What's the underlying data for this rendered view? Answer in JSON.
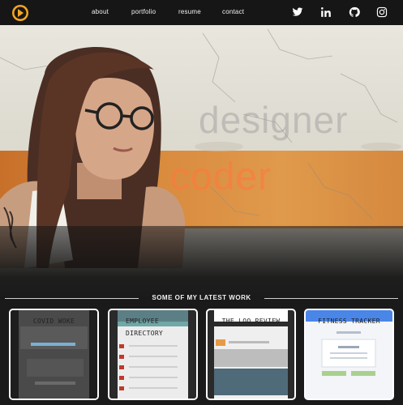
{
  "nav": {
    "links": [
      "about",
      "portfolio",
      "resume",
      "contact"
    ],
    "social_icons": [
      "twitter-icon",
      "linkedin-icon",
      "github-icon",
      "instagram-icon"
    ]
  },
  "hero": {
    "word1": "designer",
    "word2": "coder"
  },
  "section": {
    "title": "SOME OF MY LATEST WORK"
  },
  "projects": [
    {
      "title": "COVID WOKE"
    },
    {
      "title": "EMPLOYEE DIRECTORY"
    },
    {
      "title": "THE LOO REVIEW"
    },
    {
      "title": "FITNESS TRACKER"
    }
  ],
  "colors": {
    "accent": "#f5a623",
    "nav_bg": "#161616",
    "hero_band": "#d98b3e"
  }
}
